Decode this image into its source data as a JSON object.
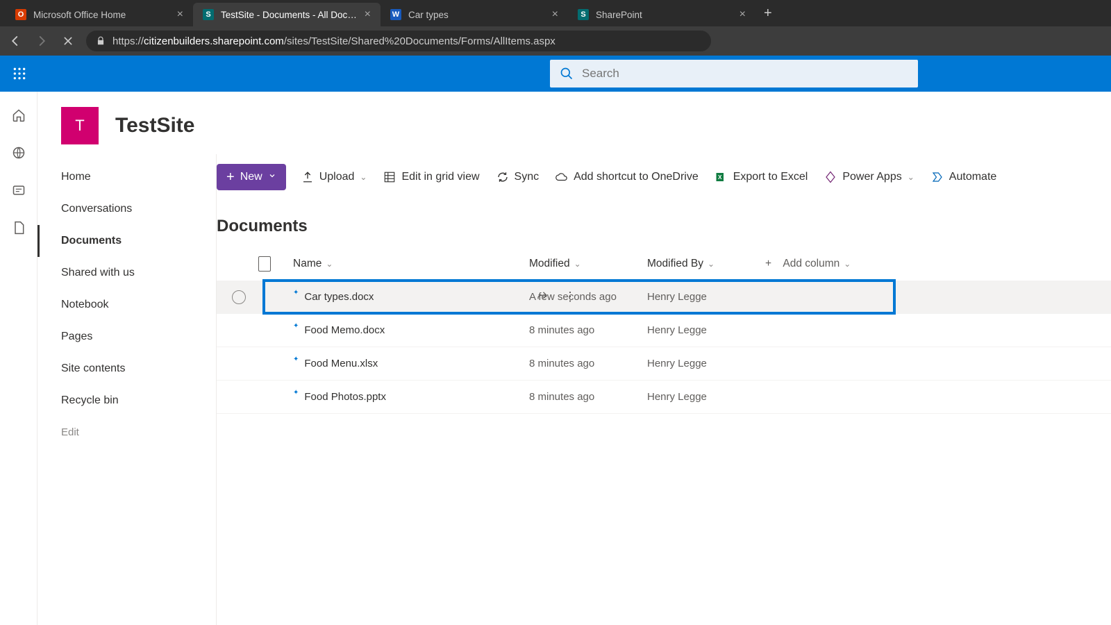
{
  "browser": {
    "tabs": [
      {
        "title": "Microsoft Office Home",
        "favicon": "O",
        "favcolor": "#d83b01",
        "active": false
      },
      {
        "title": "TestSite - Documents - All Docum",
        "favicon": "S",
        "favcolor": "#036c70",
        "active": true
      },
      {
        "title": "Car types",
        "favicon": "W",
        "favcolor": "#185abd",
        "active": false
      },
      {
        "title": "SharePoint",
        "favicon": "S",
        "favcolor": "#036c70",
        "active": false
      }
    ],
    "url_prefix": "https://",
    "url_host": "citizenbuilders.sharepoint.com",
    "url_path": "/sites/TestSite/Shared%20Documents/Forms/AllItems.aspx"
  },
  "search": {
    "placeholder": "Search"
  },
  "site": {
    "logo_letter": "T",
    "title": "TestSite"
  },
  "left_nav": {
    "items": [
      "Home",
      "Conversations",
      "Documents",
      "Shared with us",
      "Notebook",
      "Pages",
      "Site contents",
      "Recycle bin"
    ],
    "active_index": 2,
    "edit_label": "Edit"
  },
  "commands": {
    "new": "New",
    "upload": "Upload",
    "edit_grid": "Edit in grid view",
    "sync": "Sync",
    "shortcut": "Add shortcut to OneDrive",
    "export": "Export to Excel",
    "power_apps": "Power Apps",
    "automate": "Automate"
  },
  "library": {
    "title": "Documents",
    "columns": {
      "name": "Name",
      "modified": "Modified",
      "modified_by": "Modified By",
      "add": "Add column"
    },
    "rows": [
      {
        "name": "Car types.docx",
        "modified": "A few seconds ago",
        "modified_by": "Henry Legge",
        "hover": true
      },
      {
        "name": "Food Memo.docx",
        "modified": "8 minutes ago",
        "modified_by": "Henry Legge",
        "hover": false
      },
      {
        "name": "Food Menu.xlsx",
        "modified": "8 minutes ago",
        "modified_by": "Henry Legge",
        "hover": false
      },
      {
        "name": "Food Photos.pptx",
        "modified": "8 minutes ago",
        "modified_by": "Henry Legge",
        "hover": false
      }
    ]
  }
}
